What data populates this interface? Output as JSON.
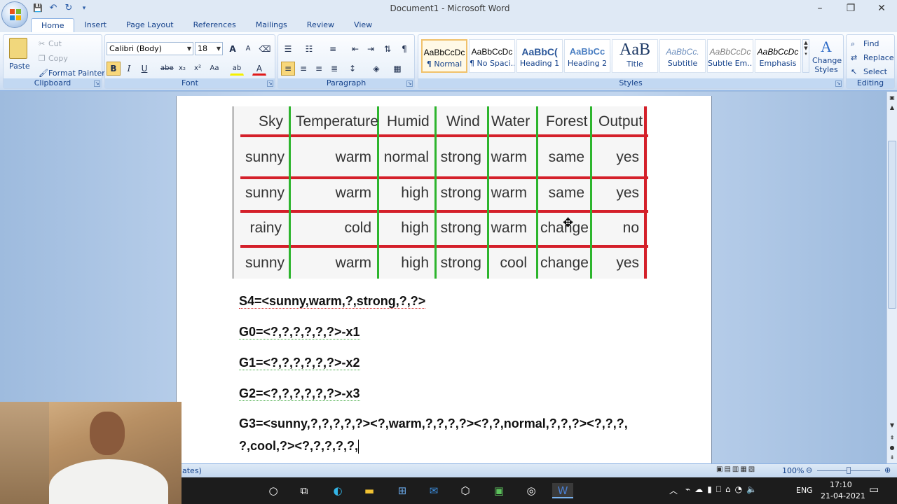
{
  "window": {
    "title": "Document1 - Microsoft Word",
    "controls": [
      "–",
      "❐",
      "✕"
    ]
  },
  "qat": {
    "save": "💾",
    "undo": "↶",
    "redo": "↻",
    "more": "▾"
  },
  "tabs": [
    "Home",
    "Insert",
    "Page Layout",
    "References",
    "Mailings",
    "Review",
    "View"
  ],
  "ribbon": {
    "clipboard": {
      "label": "Clipboard",
      "paste": "Paste",
      "cut": "Cut",
      "copy": "Copy",
      "format_painter": "Format Painter"
    },
    "font": {
      "label": "Font",
      "font_name": "Calibri (Body)",
      "font_size": "18",
      "grow": "A",
      "shrink": "A",
      "bold": "B",
      "italic": "I",
      "underline": "U",
      "strike": "abe",
      "sub": "x₂",
      "sup": "x²",
      "case": "Aa",
      "highlight": "ab",
      "color": "A"
    },
    "paragraph": {
      "label": "Paragraph",
      "pilcrow": "¶"
    },
    "styles": {
      "label": "Styles",
      "items": [
        {
          "sample": "AaBbCcDc",
          "name": "¶ Normal"
        },
        {
          "sample": "AaBbCcDc",
          "name": "¶ No Spaci..."
        },
        {
          "sample": "AaBbC(",
          "name": "Heading 1"
        },
        {
          "sample": "AaBbCc",
          "name": "Heading 2"
        },
        {
          "sample": "AaB",
          "name": "Title"
        },
        {
          "sample": "AaBbCc.",
          "name": "Subtitle"
        },
        {
          "sample": "AaBbCcDc",
          "name": "Subtle Em..."
        },
        {
          "sample": "AaBbCcDc",
          "name": "Emphasis"
        }
      ],
      "change_styles_1": "Change",
      "change_styles_2": "Styles"
    },
    "editing": {
      "label": "Editing",
      "find": "Find",
      "replace": "Replace",
      "select": "Select"
    }
  },
  "table": {
    "headers": [
      "Sky",
      "Temperature",
      "Humid",
      "Wind",
      "Water",
      "Forest",
      "Output"
    ],
    "rows": [
      [
        "sunny",
        "warm",
        "normal",
        "strong",
        "warm",
        "same",
        "yes"
      ],
      [
        "sunny",
        "warm",
        "high",
        "strong",
        "warm",
        "same",
        "yes"
      ],
      [
        "rainy",
        "cold",
        "high",
        "strong",
        "warm",
        "change",
        "no"
      ],
      [
        "sunny",
        "warm",
        "high",
        "strong",
        "cool",
        "change",
        "yes"
      ]
    ]
  },
  "doc_lines": {
    "s4": "S4=<sunny,warm,?,strong,?,?>",
    "g0": "G0=<?,?,?,?,?,?>-x1",
    "g1": "G1=<?,?,?,?,?,?>-x2",
    "g2": "G2=<?,?,?,?,?,?>-x3",
    "g3a": "G3=<sunny,?,?,?,?,?><?,warm,?,?,?,?><?,?,normal,?,?,?><?,?,?,",
    "g3b": "?,cool,?><?,?,?,?,?,"
  },
  "statusbar": {
    "left_fragment": "ates)",
    "zoom": "100%"
  },
  "taskbar": {
    "lang": "ENG",
    "time": "17:10",
    "date": "21-04-2021"
  }
}
